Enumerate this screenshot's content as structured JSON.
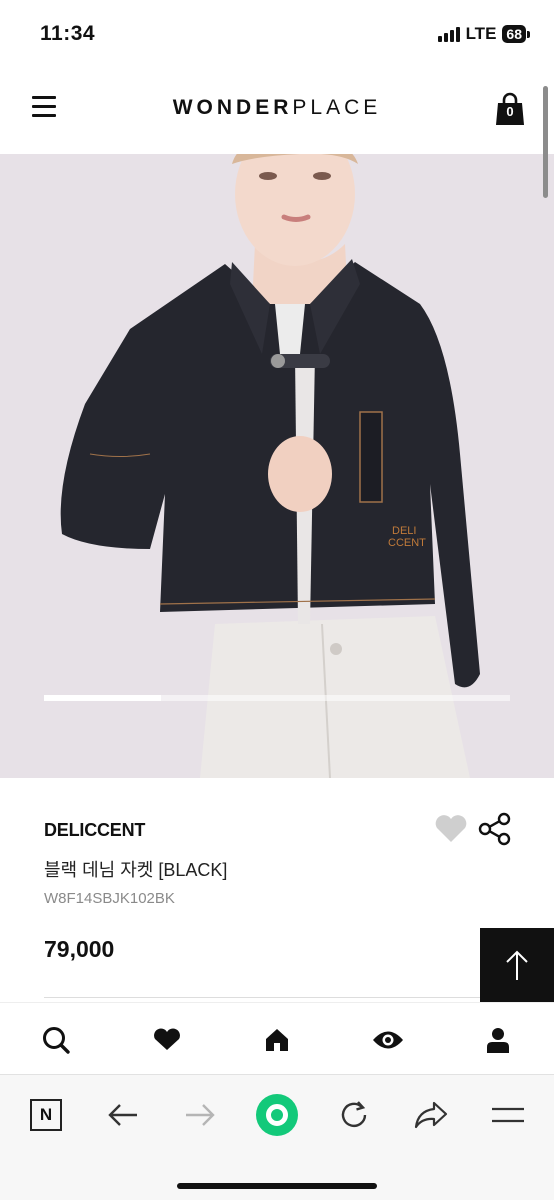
{
  "status_bar": {
    "time": "11:34",
    "network": "LTE",
    "battery": "68"
  },
  "header": {
    "logo_bold": "WONDER",
    "logo_light": "PLACE",
    "cart_count": "0",
    "menu_icon": "hamburger-icon",
    "cart_icon": "shopping-bag-icon"
  },
  "hero": {
    "image": "product-photo-black-denim-jacket",
    "jacket_text_line1": "DELI",
    "jacket_text_line2": "CCENT",
    "carousel_progress": 0.25,
    "background_color": "#e7e1e7"
  },
  "product": {
    "brand": "DELICCENT",
    "name": "블랙 데님 자켓 [BLACK]",
    "code": "W8F14SBJK102BK",
    "price": "79,000",
    "wish_icon": "heart-icon",
    "share_icon": "share-icon"
  },
  "scroll_top": {
    "icon": "arrow-up-icon"
  },
  "bottom_nav": {
    "items": [
      {
        "icon": "search-icon"
      },
      {
        "icon": "heart-icon"
      },
      {
        "icon": "home-icon"
      },
      {
        "icon": "eye-icon"
      },
      {
        "icon": "user-icon"
      }
    ]
  },
  "browser_toolbar": {
    "items": [
      {
        "icon": "naver-n-icon",
        "label": "N"
      },
      {
        "icon": "back-arrow-icon"
      },
      {
        "icon": "forward-arrow-icon"
      },
      {
        "icon": "green-circle-icon"
      },
      {
        "icon": "refresh-icon"
      },
      {
        "icon": "share-arrow-icon"
      },
      {
        "icon": "menu-lines-icon"
      }
    ]
  },
  "colors": {
    "accent_green": "#13c97a",
    "text_primary": "#111111",
    "text_secondary": "#8a8a8a",
    "wish_gray": "#cfcfcf"
  }
}
